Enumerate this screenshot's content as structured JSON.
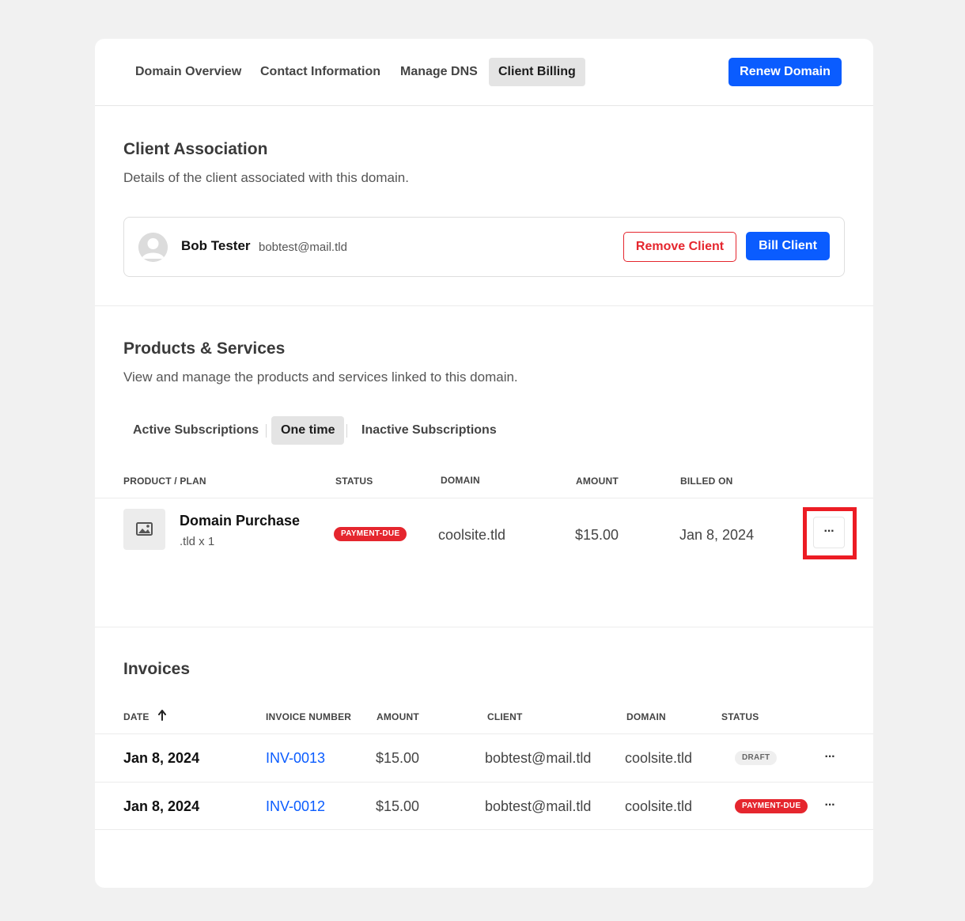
{
  "nav": {
    "tabs": [
      {
        "label": "Domain Overview"
      },
      {
        "label": "Contact Information"
      },
      {
        "label": "Manage DNS"
      },
      {
        "label": "Client Billing",
        "active": true
      }
    ],
    "renew_label": "Renew Domain"
  },
  "client_section": {
    "title": "Client Association",
    "description": "Details of the client associated with this domain.",
    "client": {
      "name": "Bob Tester",
      "email": "bobtest@mail.tld"
    },
    "remove_label": "Remove Client",
    "bill_label": "Bill Client"
  },
  "products_section": {
    "title": "Products & Services",
    "description": "View and manage the products and services linked to this domain.",
    "tabs": [
      {
        "label": "Active Subscriptions"
      },
      {
        "label": "One time",
        "active": true
      },
      {
        "label": "Inactive Subscriptions"
      }
    ],
    "columns": [
      "PRODUCT / PLAN",
      "STATUS",
      "DOMAIN",
      "AMOUNT",
      "BILLED ON"
    ],
    "rows": [
      {
        "name": "Domain Purchase",
        "plan": ".tld x 1",
        "status": "PAYMENT-DUE",
        "domain": "coolsite.tld",
        "amount": "$15.00",
        "billed_on": "Jan 8, 2024",
        "actions": "···"
      }
    ]
  },
  "invoices_section": {
    "title": "Invoices",
    "columns": [
      "DATE",
      "INVOICE NUMBER",
      "AMOUNT",
      "CLIENT",
      "DOMAIN",
      "STATUS"
    ],
    "rows": [
      {
        "date": "Jan 8, 2024",
        "number": "INV-0013",
        "amount": "$15.00",
        "client": "bobtest@mail.tld",
        "domain": "coolsite.tld",
        "status": "DRAFT",
        "actions": "···"
      },
      {
        "date": "Jan 8, 2024",
        "number": "INV-0012",
        "amount": "$15.00",
        "client": "bobtest@mail.tld",
        "domain": "coolsite.tld",
        "status": "PAYMENT-DUE",
        "actions": "···"
      }
    ]
  },
  "colors": {
    "accent": "#0a5cff",
    "danger": "#e5262e",
    "highlight": "#ec1c24"
  }
}
